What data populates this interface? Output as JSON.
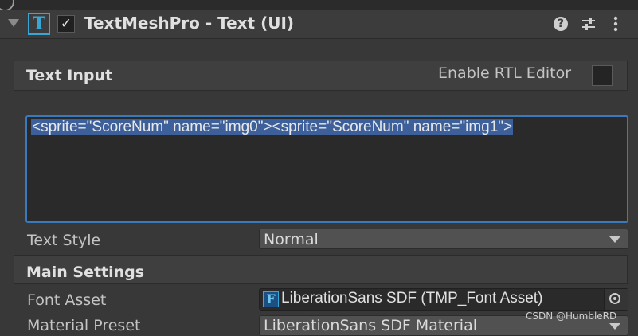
{
  "component": {
    "title": "TextMeshPro - Text (UI)",
    "enabled": true
  },
  "text_input_section": {
    "title": "Text Input",
    "rtl_label": "Enable RTL Editor",
    "rtl_enabled": false,
    "text_value": "<sprite=\"ScoreNum\" name=\"img0\"><sprite=\"ScoreNum\" name=\"img1\">"
  },
  "text_style": {
    "label": "Text Style",
    "value": "Normal"
  },
  "main_settings": {
    "title": "Main Settings",
    "font_asset_label": "Font Asset",
    "font_asset_value": "LiberationSans SDF (TMP_Font Asset)",
    "material_preset_label": "Material Preset",
    "material_preset_value": "LiberationSans SDF Material"
  },
  "watermark": "CSDN @HumbleRD",
  "colors": {
    "background": "#383838",
    "accent": "#3a79bb",
    "selection": "#3d5f9a",
    "tmp_icon": "#3aa6d6"
  }
}
